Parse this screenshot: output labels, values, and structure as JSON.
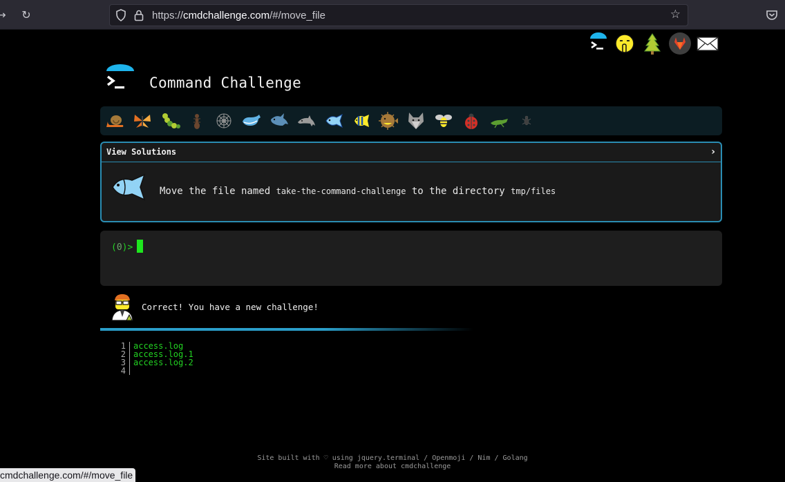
{
  "browser": {
    "url_prefix": "https://",
    "url_host": "cmdchallenge.com",
    "url_path": "/#/move_file"
  },
  "header": {
    "title": "Command Challenge"
  },
  "strip": {
    "items": [
      "snail",
      "butterfly",
      "caterpillar",
      "ant",
      "spider-web",
      "whale",
      "shark",
      "dolphin",
      "fish",
      "tropical-fish",
      "blowfish",
      "wolf",
      "bee",
      "ladybug",
      "cricket",
      "bug"
    ],
    "selected": "fish"
  },
  "solutions": {
    "header_label": "View Solutions",
    "chevron": "›",
    "task_prefix": "Move the file named",
    "task_file": "take-the-command-challenge",
    "task_middle": "to the directory",
    "task_dir": "tmp/files"
  },
  "terminal": {
    "prompt_open": "(",
    "prompt_num": "0",
    "prompt_close": ")>"
  },
  "message": {
    "text": "Correct! You have a new challenge!"
  },
  "listing": {
    "rows": [
      {
        "n": "1",
        "v": "access.log"
      },
      {
        "n": "2",
        "v": "access.log.1"
      },
      {
        "n": "3",
        "v": "access.log.2"
      },
      {
        "n": "4",
        "v": ""
      }
    ]
  },
  "footer": {
    "line1": "Site built with ♡ using jquery.terminal / Openmoji / Nim / Golang",
    "line2": "Read more about cmdchallenge"
  },
  "status": {
    "link": "cmdchallenge.com/#/move_file"
  },
  "colors": {
    "accent": "#2a8db3",
    "terminal_green": "#22d322",
    "background": "#000000"
  }
}
